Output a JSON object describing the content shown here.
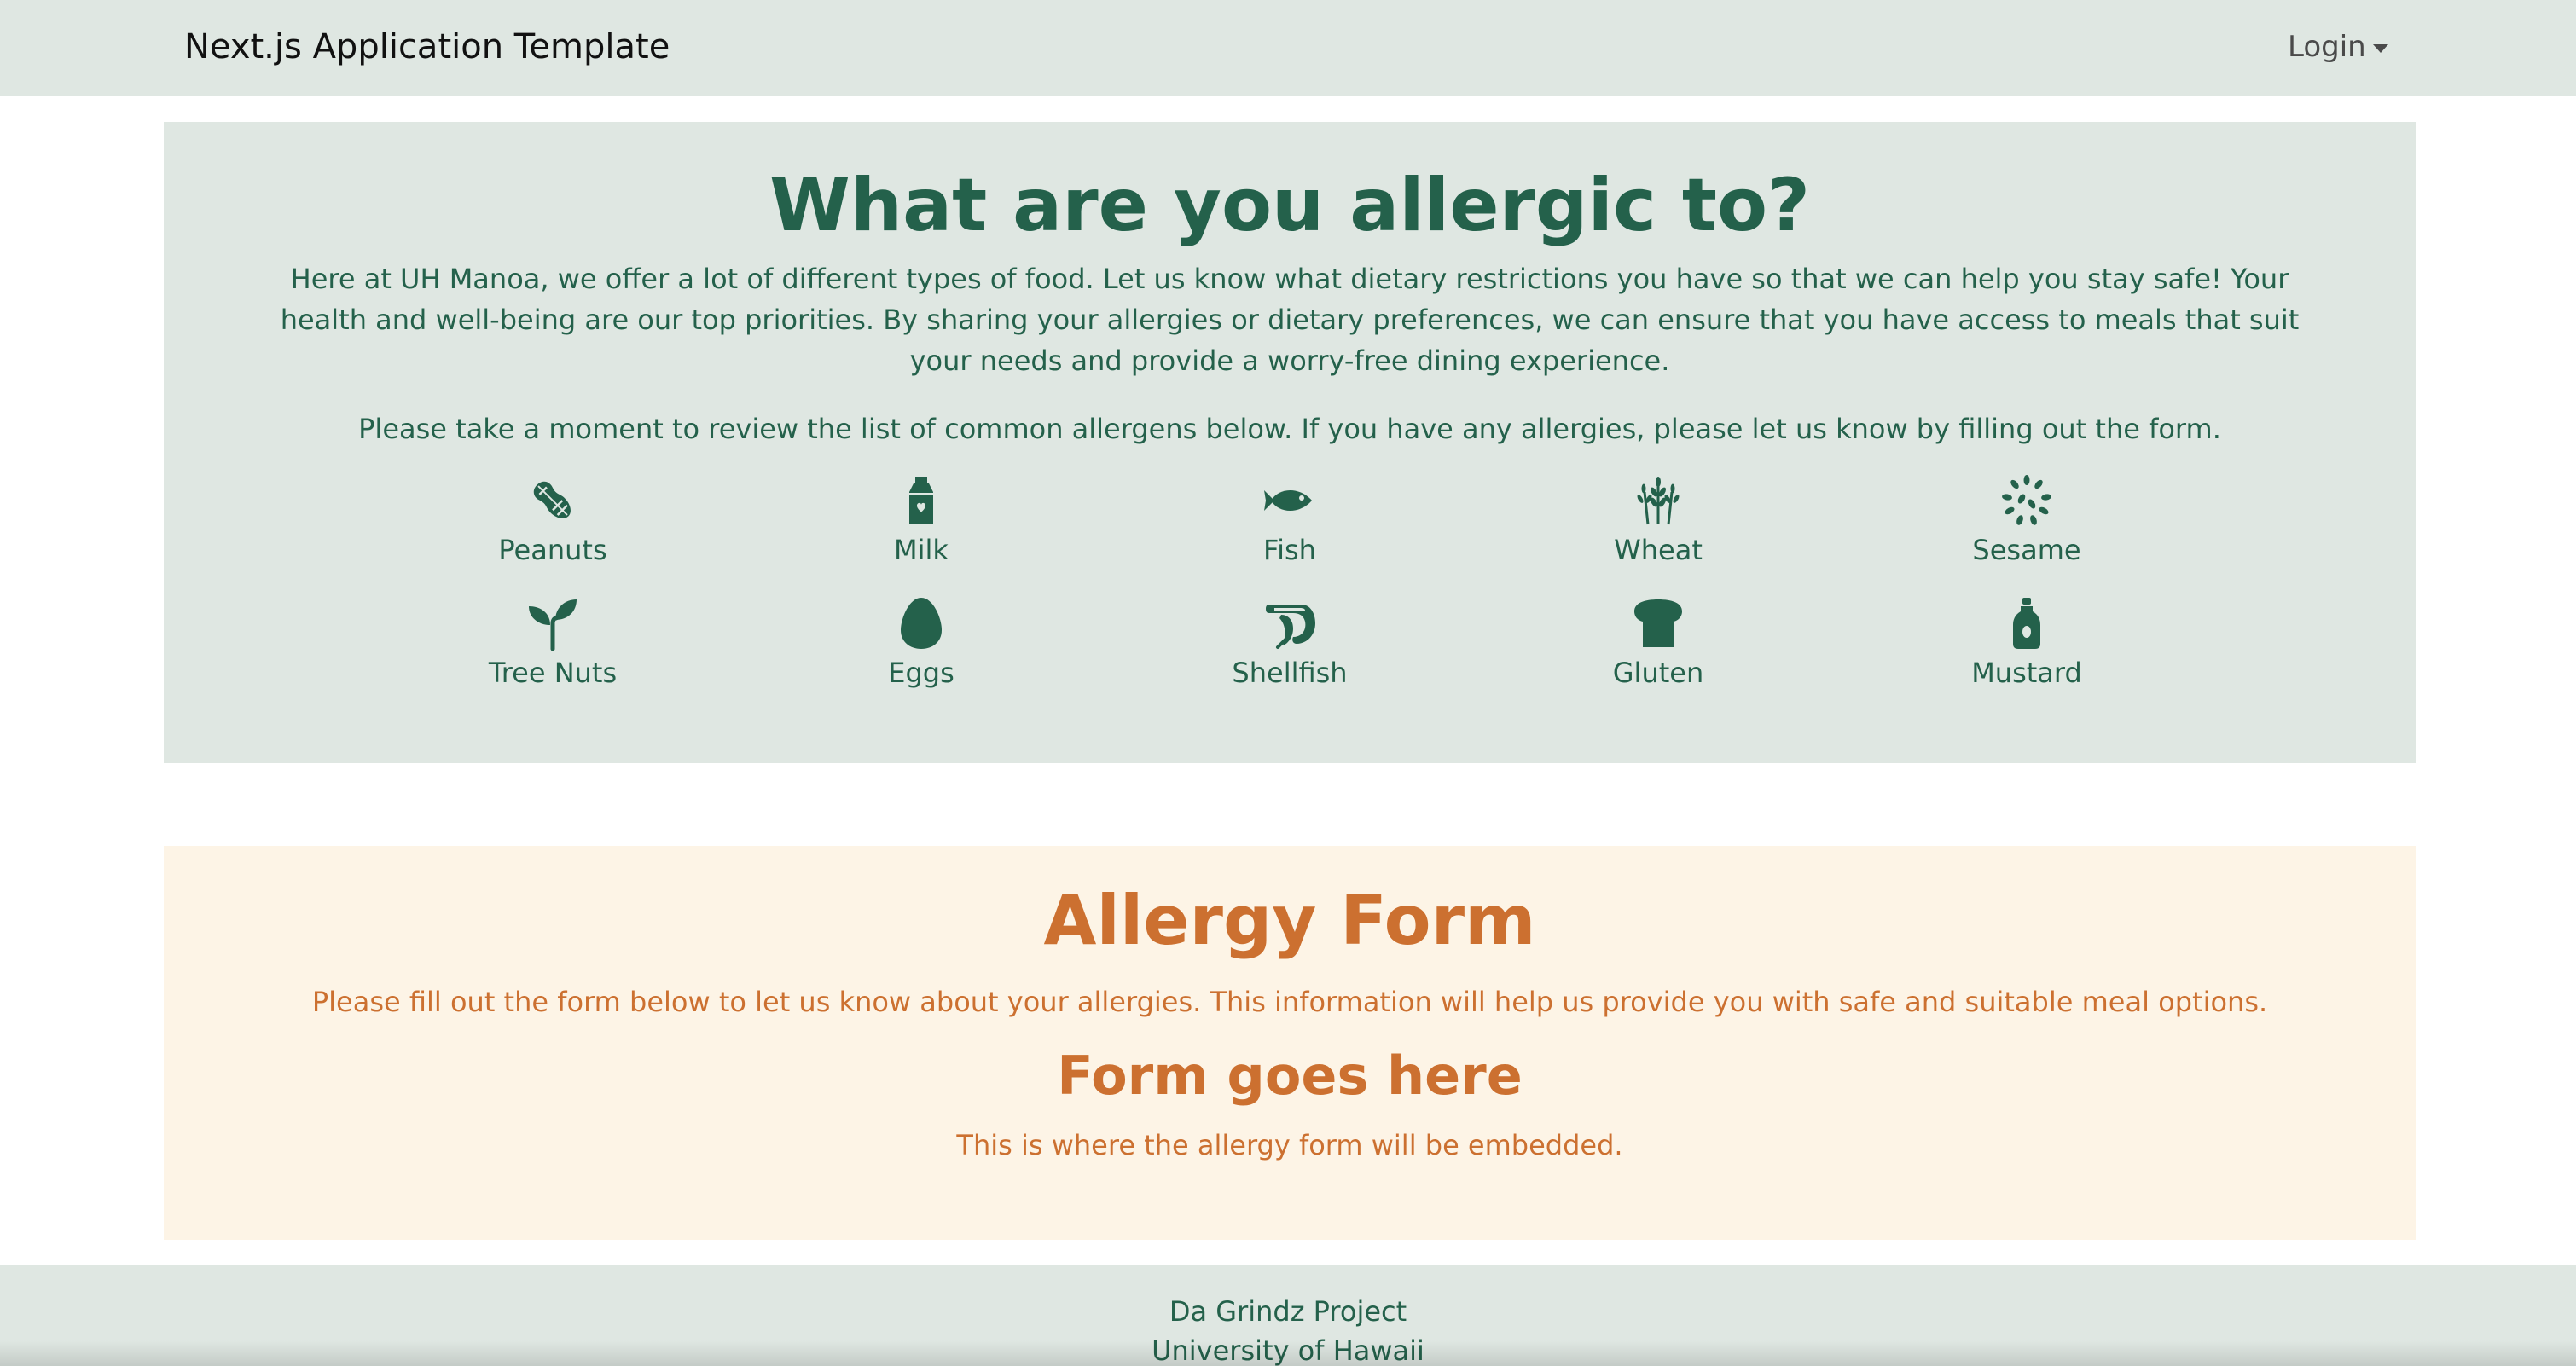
{
  "navbar": {
    "brand": "Next.js Application Template",
    "login_label": "Login",
    "background_color": "#dfe7e2"
  },
  "allergens_section": {
    "title": "What are you allergic to?",
    "intro": "Here at UH Manoa, we offer a lot of different types of food. Let us know what dietary restrictions you have so that we can help you stay safe! Your health and well-being are our top priorities. By sharing your allergies or dietary preferences, we can ensure that you have access to meals that suit your needs and provide a worry-free dining experience.",
    "intro2": "Please take a moment to review the list of common allergens below. If you have any allergies, please let us know by filling out the form.",
    "accent_color": "#24614b",
    "background_color": "#dfe7e2",
    "items": [
      {
        "label": "Peanuts",
        "icon": "peanut-icon"
      },
      {
        "label": "Milk",
        "icon": "milk-carton-icon"
      },
      {
        "label": "Fish",
        "icon": "fish-icon"
      },
      {
        "label": "Wheat",
        "icon": "wheat-icon"
      },
      {
        "label": "Sesame",
        "icon": "sesame-seeds-icon"
      },
      {
        "label": "Tree Nuts",
        "icon": "sprout-icon"
      },
      {
        "label": "Eggs",
        "icon": "egg-icon"
      },
      {
        "label": "Shellfish",
        "icon": "shrimp-icon"
      },
      {
        "label": "Gluten",
        "icon": "bread-icon"
      },
      {
        "label": "Mustard",
        "icon": "mustard-bottle-icon"
      }
    ]
  },
  "form_section": {
    "title": "Allergy Form",
    "description": "Please fill out the form below to let us know about your allergies. This information will help us provide you with safe and suitable meal options.",
    "placeholder_title": "Form goes here",
    "placeholder_text": "This is where the allergy form will be embedded.",
    "accent_color": "#cc7030",
    "background_color": "#fdf4e6"
  },
  "footer": {
    "line1": "Da Grindz Project",
    "line2": "University of Hawaii"
  }
}
